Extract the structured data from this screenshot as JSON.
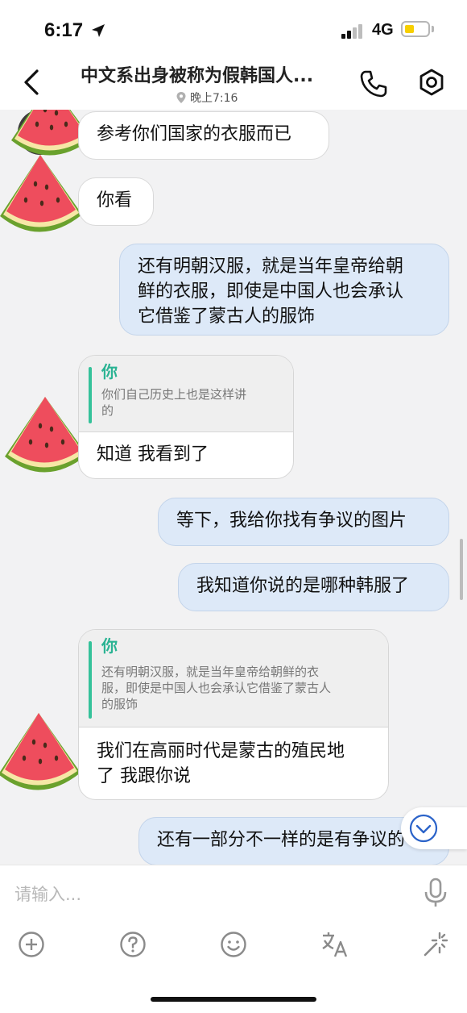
{
  "status_bar": {
    "time": "6:17",
    "network": "4G"
  },
  "header": {
    "title": "中文系出身被称为假韩国人...",
    "subtitle": "晚上7:16"
  },
  "messages": [
    {
      "type": "incoming",
      "text": "参考你们国家的衣服而已"
    },
    {
      "type": "incoming",
      "text": "你看"
    },
    {
      "type": "outgoing",
      "lines": [
        "还有明朝汉服，就是当年皇帝给朝",
        "鲜的衣服，即使是中国人也会承认",
        "它借鉴了蒙古人的服饰"
      ]
    },
    {
      "type": "incoming_quote",
      "quote_name": "你",
      "quote_lines": [
        "你们自己历史上也是这样讲",
        "的"
      ],
      "text": "知道 我看到了"
    },
    {
      "type": "outgoing",
      "text": "等下，我给你找有争议的图片"
    },
    {
      "type": "outgoing",
      "text": "我知道你说的是哪种韩服了"
    },
    {
      "type": "incoming_quote",
      "quote_name": "你",
      "quote_lines": [
        "还有明朝汉服，就是当年皇帝给朝鲜的衣",
        "服，即使是中国人也会承认它借鉴了蒙古人",
        "的服饰"
      ],
      "lines": [
        "我们在高丽时代是蒙古的殖民地",
        "了 我跟你说"
      ]
    },
    {
      "type": "outgoing",
      "text": "还有一部分不一样的是有争议的"
    }
  ],
  "composer": {
    "placeholder": "请输入..."
  },
  "icons": [
    "back-icon",
    "phone-icon",
    "settings-icon",
    "location-icon",
    "microphone-icon",
    "add-icon",
    "help-icon",
    "emoji-icon",
    "translate-icon",
    "magic-icon",
    "scroll-down-icon",
    "watermelon-avatar"
  ],
  "colors": {
    "outgoing_bubble": "#dde9f8",
    "quote_accent": "#35c29a",
    "battery": "#f7cf00"
  }
}
